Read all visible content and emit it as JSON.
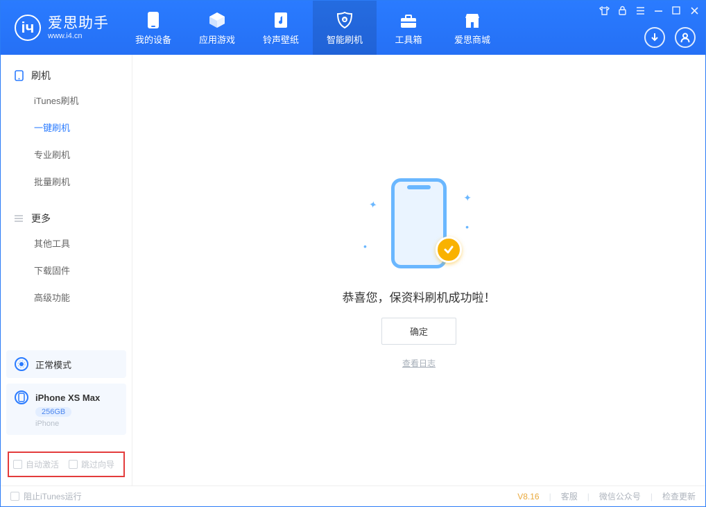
{
  "app": {
    "title": "爱思助手",
    "url": "www.i4.cn"
  },
  "tabs": [
    {
      "label": "我的设备",
      "icon": "device"
    },
    {
      "label": "应用游戏",
      "icon": "cube"
    },
    {
      "label": "铃声壁纸",
      "icon": "music"
    },
    {
      "label": "智能刷机",
      "icon": "shield",
      "active": true
    },
    {
      "label": "工具箱",
      "icon": "toolbox"
    },
    {
      "label": "爱思商城",
      "icon": "store"
    }
  ],
  "sidebar": {
    "section1": {
      "title": "刷机",
      "items": [
        "iTunes刷机",
        "一键刷机",
        "专业刷机",
        "批量刷机"
      ],
      "active_index": 1
    },
    "section2": {
      "title": "更多",
      "items": [
        "其他工具",
        "下载固件",
        "高级功能"
      ]
    },
    "mode_card": {
      "label": "正常模式"
    },
    "device_card": {
      "name": "iPhone XS Max",
      "storage": "256GB",
      "type": "iPhone"
    },
    "options": {
      "opt1": "自动激活",
      "opt2": "跳过向导"
    }
  },
  "main": {
    "message": "恭喜您，保资料刷机成功啦！",
    "ok": "确定",
    "view_log": "查看日志"
  },
  "footer": {
    "block_itunes": "阻止iTunes运行",
    "version": "V8.16",
    "support": "客服",
    "wechat": "微信公众号",
    "update": "检查更新"
  }
}
